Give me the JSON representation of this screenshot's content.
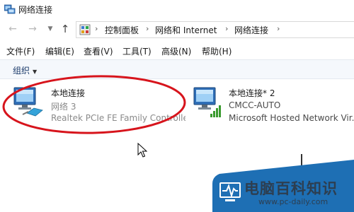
{
  "window": {
    "title": "网络连接"
  },
  "breadcrumb": [
    {
      "label": "控制面板"
    },
    {
      "label": "网络和 Internet"
    },
    {
      "label": "网络连接"
    }
  ],
  "menu": [
    {
      "label": "文件(F)"
    },
    {
      "label": "编辑(E)"
    },
    {
      "label": "查看(V)"
    },
    {
      "label": "工具(T)"
    },
    {
      "label": "高级(N)"
    },
    {
      "label": "帮助(H)"
    }
  ],
  "command_bar": {
    "organize_label": "组织"
  },
  "connections": [
    {
      "name": "本地连接",
      "network": "网络  3",
      "device": "Realtek PCIe FE Family Controller",
      "icon": "ethernet-adapter-icon"
    },
    {
      "name": "本地连接* 2",
      "network": "CMCC-AUTO",
      "device": "Microsoft Hosted Network Vir...",
      "icon": "wireless-adapter-icon"
    }
  ],
  "watermark": {
    "text": "电脑百科知识",
    "url": "www.pc-daily.com"
  },
  "colors": {
    "annotation_red": "#d7141c",
    "watermark_blue": "#1e6fb4",
    "signal_green": "#3a9a2e"
  }
}
